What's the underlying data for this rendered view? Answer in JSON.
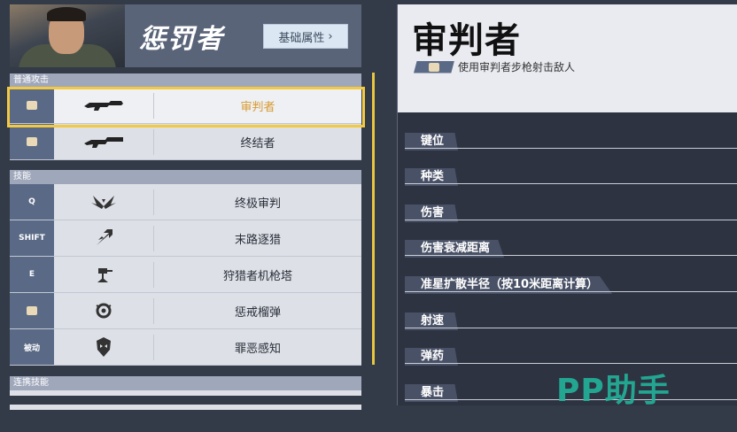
{
  "hero": {
    "name": "惩罚者",
    "attr_button": "基础属性",
    "attr_chevron": "›"
  },
  "sections": {
    "normal_attack": "普通攻击",
    "skills": "技能",
    "combo": "连携技能"
  },
  "weapons": [
    {
      "key_icon": "flag-icon",
      "icon": "rifle-icon",
      "name": "审判者",
      "selected": true
    },
    {
      "key_icon": "flag-icon",
      "icon": "shotgun-icon",
      "name": "终结者",
      "selected": false
    }
  ],
  "skills": [
    {
      "key": "Q",
      "icon": "wings-icon",
      "name": "终极审判"
    },
    {
      "key": "SHIFT",
      "icon": "slash-icon",
      "name": "末路逐猎"
    },
    {
      "key": "E",
      "icon": "turret-icon",
      "name": "狩猎者机枪塔"
    },
    {
      "key": "",
      "key_icon": "flag-icon",
      "icon": "grenade-icon",
      "name": "惩戒榴弹"
    },
    {
      "key": "被动",
      "icon": "helmet-icon",
      "name": "罪恶感知"
    }
  ],
  "detail": {
    "title": "审判者",
    "description": "使用审判者步枪射击敌人",
    "stats": [
      "键位",
      "种类",
      "伤害",
      "伤害衰减距离",
      "准星扩散半径（按10米距离计算）",
      "射速",
      "弹药",
      "暴击"
    ]
  },
  "watermark": "PP助手",
  "colors": {
    "accent_gold": "#f2c940",
    "selected_text": "#d99a30",
    "key_bg": "#5a6a86",
    "watermark": "#22b39a"
  }
}
